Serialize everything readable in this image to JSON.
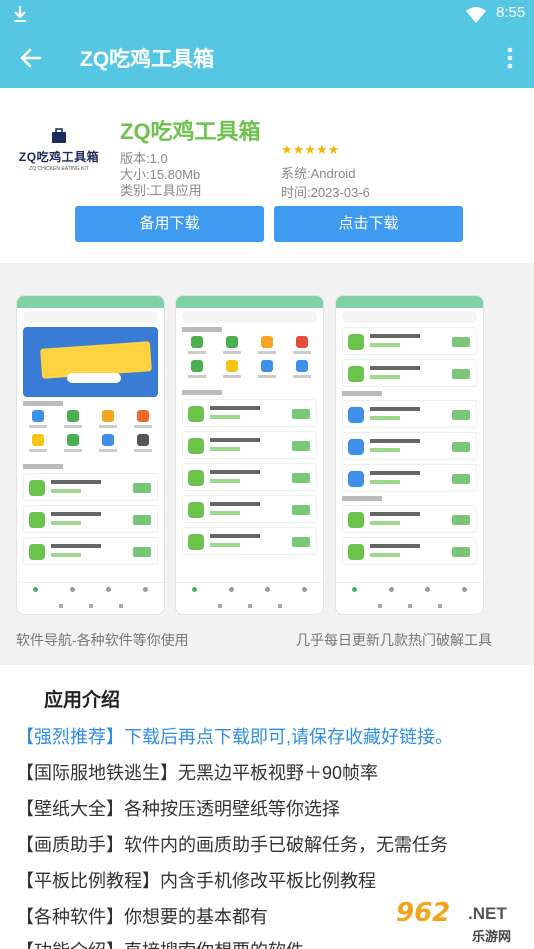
{
  "status_bar": {
    "time": "8:55"
  },
  "app_bar": {
    "title": "ZQ吃鸡工具箱"
  },
  "app": {
    "logo_text": "ZQ吃鸡工具箱",
    "logo_sub": "ZQ CHICKEN EATING KIT",
    "name": "ZQ吃鸡工具箱",
    "version": "版本:1.0",
    "size": "大小:15.80Mb",
    "category": "类别:工具应用",
    "rating_stars": "★★★★★",
    "system": "系统:Android",
    "time": "时间:2023-03-6",
    "buttons": {
      "backup_download": "备用下载",
      "download": "点击下载"
    }
  },
  "screenshots": {
    "caption_left": "软件导航-各种软件等你使用",
    "caption_right": "几乎每日更新几款热门破解工具"
  },
  "description": {
    "title": "应用介绍",
    "lines": [
      "【强烈推荐】下载后再点下载即可,请保存收藏好链接。",
      "【国际服地铁逃生】无黑边平板视野＋90帧率",
      "【壁纸大全】各种按压透明壁纸等你选择",
      "【画质助手】软件内的画质助手已破解任务，无需任务",
      "【平板比例教程】内含手机修改平板比例教程",
      "【各种软件】你想要的基本都有",
      "【功能介绍】直接搜索你想要的软件"
    ]
  },
  "watermark": {
    "number": "962",
    "net": ".NET",
    "cn": "乐游网"
  },
  "colors": {
    "accent": "#56c7e3",
    "button": "#3e9bf0",
    "app_name": "#6cc24a",
    "highlight": "#2f8de4"
  },
  "icons": [
    "download-icon",
    "wifi-icon",
    "battery-icon",
    "back-arrow-icon",
    "more-vertical-icon",
    "star-icon"
  ]
}
